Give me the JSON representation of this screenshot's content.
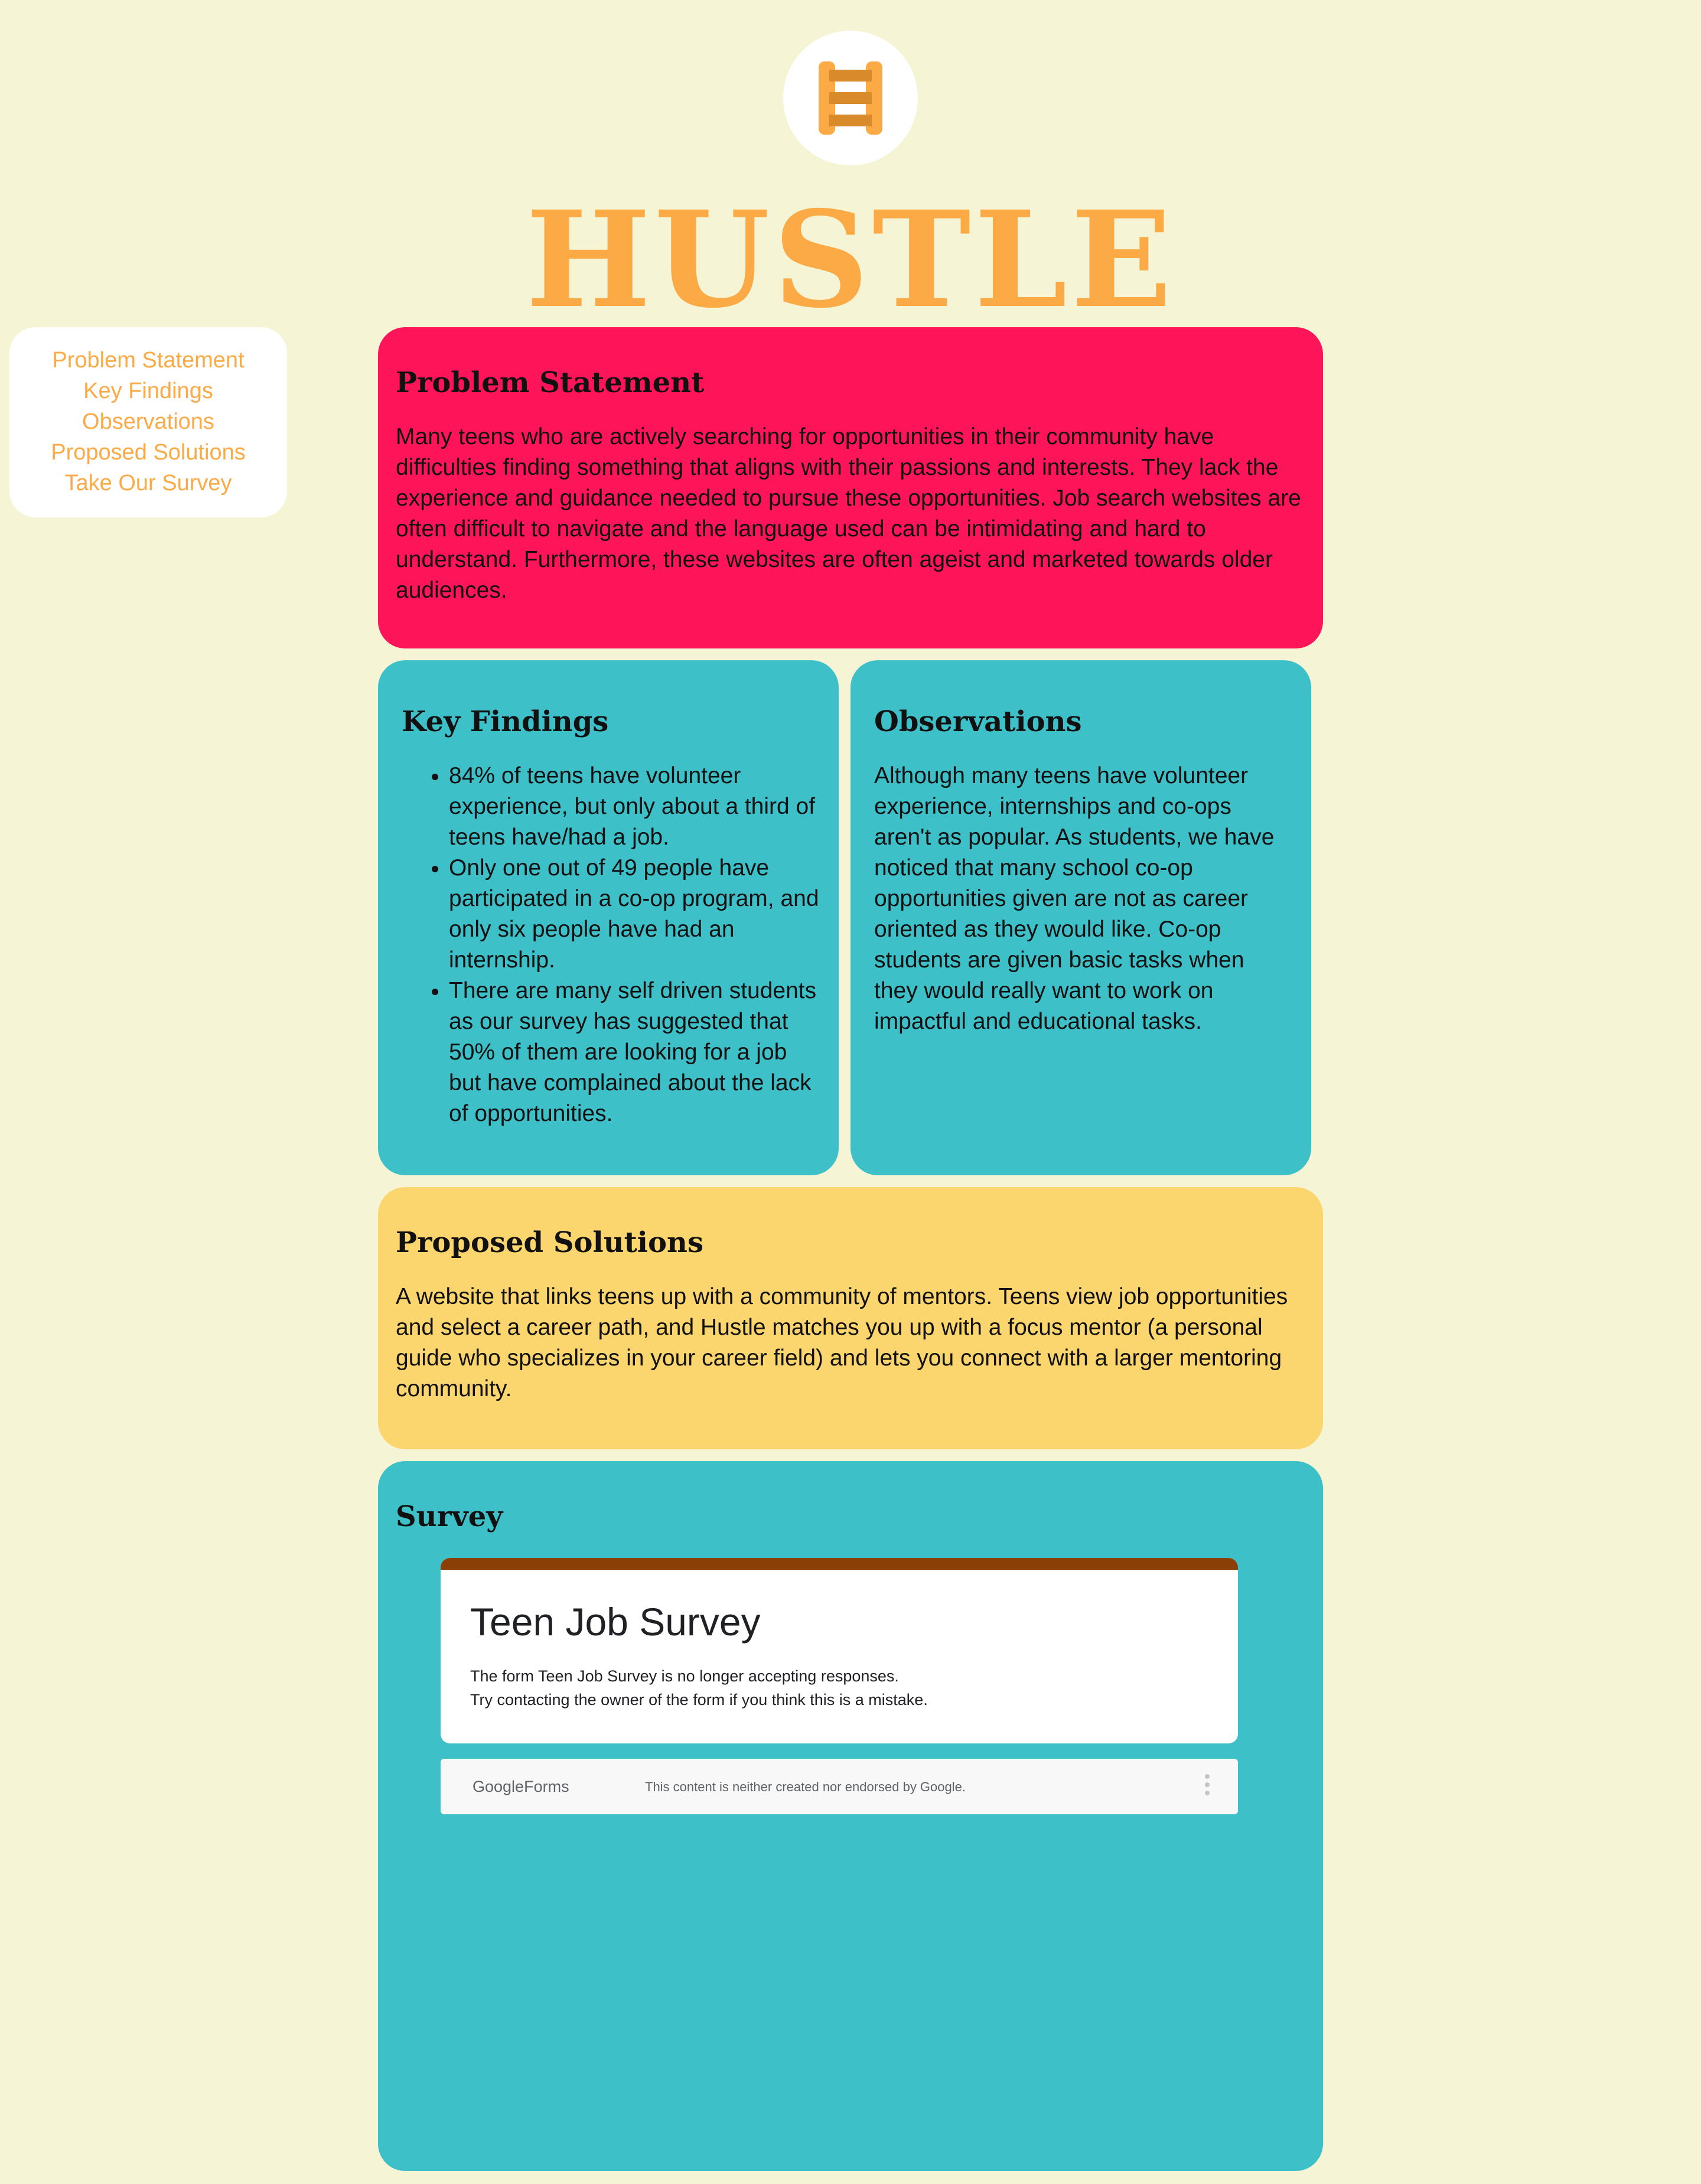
{
  "brand": {
    "title": "HUSTLE",
    "logo_icon": "ladder-icon",
    "accent_color": "#fbaa45"
  },
  "nav": {
    "items": [
      {
        "label": "Problem Statement"
      },
      {
        "label": "Key Findings"
      },
      {
        "label": "Observations"
      },
      {
        "label": "Proposed Solutions"
      },
      {
        "label": "Take Our Survey"
      }
    ]
  },
  "problem": {
    "heading": "Problem Statement",
    "body": "Many teens who are actively searching for opportunities in their community have difficulties finding something that aligns with their passions and interests. They lack the experience and guidance needed to pursue these opportunities. Job search websites are often difficult to navigate and the language used can be intimidating and hard to understand. Furthermore, these websites are often ageist and marketed towards older audiences.",
    "color": "#fe1459"
  },
  "findings": {
    "heading": "Key Findings",
    "items": [
      "84% of teens have volunteer experience, but only about a third of teens have/had a job.",
      "Only one out of 49 people have participated in a co-op program, and only six people have had an internship.",
      "There are many self driven students as our survey has suggested that 50% of them are looking for a job but have complained about the lack of opportunities."
    ],
    "color": "#3ec0c9"
  },
  "observations": {
    "heading": "Observations",
    "body": "Although many teens have volunteer experience, internships and co-ops aren't as popular. As students, we have noticed that many school co-op opportunities given are not as career oriented as they would like. Co-op students are given basic tasks when they would really want to work on impactful and educational tasks."
  },
  "solutions": {
    "heading": "Proposed Solutions",
    "body": "A website that links teens up with a community of mentors. Teens view job opportunities and select a career path, and Hustle matches you up with a focus mentor (a personal guide who specializes in your career field) and lets you connect with a larger mentoring community.",
    "color": "#fbd56e"
  },
  "survey": {
    "heading": "Survey",
    "form": {
      "title": "Teen Job Survey",
      "message_line1": "The form Teen Job Survey is no longer accepting responses.",
      "message_line2": "Try contacting the owner of the form if you think this is a mistake.",
      "footer_logo_google": "Google",
      "footer_logo_forms": "Forms",
      "footer_note": "This content is neither created nor endorsed by Google.",
      "topbar_color": "#8a3f06"
    }
  }
}
